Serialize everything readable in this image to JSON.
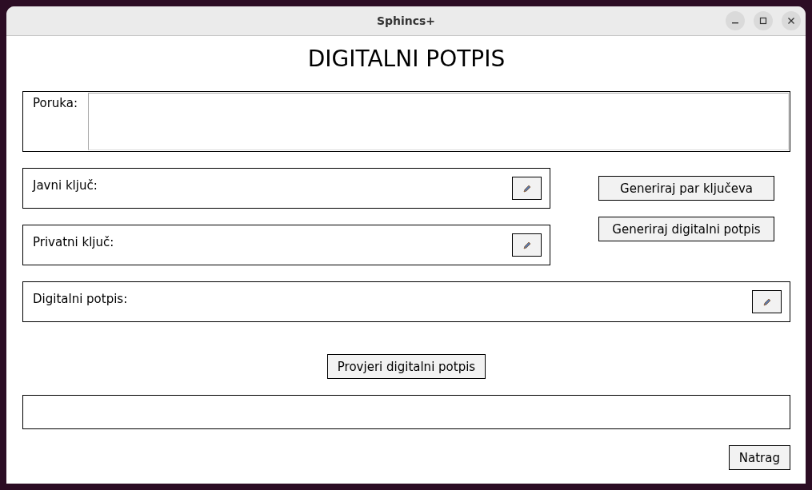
{
  "window": {
    "title": "Sphincs+"
  },
  "heading": "DIGITALNI POTPIS",
  "message": {
    "label": "Poruka:"
  },
  "fields": [
    {
      "label": "Javni ključ:"
    },
    {
      "label": "Privatni ključ:"
    }
  ],
  "side_buttons": [
    "Generiraj par ključeva",
    "Generiraj digitalni potpis"
  ],
  "signature": {
    "label": "Digitalni potpis:"
  },
  "verify_button": "Provjeri digitalni potpis",
  "back_button": "Natrag"
}
